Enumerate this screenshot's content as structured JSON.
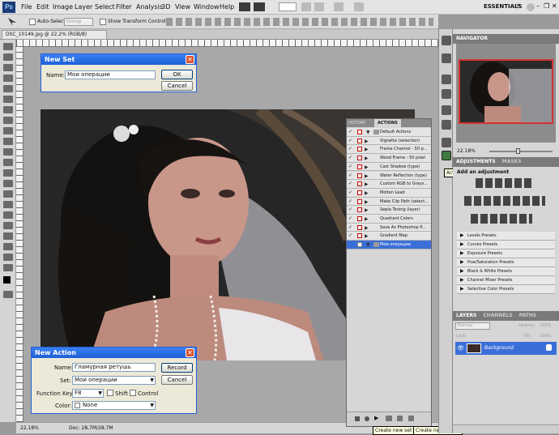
{
  "app": {
    "logo": "Ps",
    "workspace": "ESSENTIALS",
    "cs_live": "CS Live"
  },
  "menu": [
    "File",
    "Edit",
    "Image",
    "Layer",
    "Select",
    "Filter",
    "Analysis",
    "3D",
    "View",
    "Window",
    "Help"
  ],
  "options": {
    "auto_select_label": "Auto-Select:",
    "auto_select_value": "Group",
    "transform_label": "Show Transform Controls"
  },
  "document": {
    "tab_title": "DSC_10149.jpg @ 22,2% (RGB/8)"
  },
  "status": {
    "zoom": "22,18%",
    "doc": "Doc: 28,7M/28,7M"
  },
  "new_set_dialog": {
    "title": "New Set",
    "name_label": "Name:",
    "name_value": "Мои операции",
    "ok": "OK",
    "cancel": "Cancel"
  },
  "new_action_dialog": {
    "title": "New Action",
    "name_label": "Name:",
    "name_value": "Гламурная ретушь",
    "set_label": "Set:",
    "set_value": "Мои операции",
    "fkey_label": "Function Key:",
    "fkey_value": "F8",
    "shift": "Shift",
    "control": "Control",
    "color_label": "Color:",
    "color_value": "None",
    "record": "Record",
    "cancel": "Cancel"
  },
  "actions_panel": {
    "tabs": [
      "HISTORY",
      "ACTIONS"
    ],
    "items": [
      {
        "name": "Default Actions",
        "folder": true
      },
      {
        "name": "Vignette (selection)"
      },
      {
        "name": "Frame Channel - 50 p..."
      },
      {
        "name": "Wood Frame - 50 pixel"
      },
      {
        "name": "Cast Shadow (type)"
      },
      {
        "name": "Water Reflection (type)"
      },
      {
        "name": "Custom RGB to Grays..."
      },
      {
        "name": "Molten Lead"
      },
      {
        "name": "Make Clip Path (select..."
      },
      {
        "name": "Sepia Toning (layer)"
      },
      {
        "name": "Quadrant Colors"
      },
      {
        "name": "Save As Photoshop P..."
      },
      {
        "name": "Gradient Map"
      },
      {
        "name": "Мои операции",
        "selected": true
      }
    ],
    "tip_new_set": "Create new set",
    "tip_new_action": "Create new action"
  },
  "dock_tooltip": "Actions",
  "navigator": {
    "title": "NAVIGATOR",
    "zoom": "22.18%"
  },
  "adjustments": {
    "tabs": [
      "ADJUSTMENTS",
      "MASKS"
    ],
    "heading": "Add an adjustment",
    "presets": [
      "Levels Presets",
      "Curves Presets",
      "Exposure Presets",
      "Hue/Saturation Presets",
      "Black & White Presets",
      "Channel Mixer Presets",
      "Selective Color Presets"
    ]
  },
  "layers": {
    "tabs": [
      "LAYERS",
      "CHANNELS",
      "PATHS"
    ],
    "blend": "Normal",
    "opacity_label": "Opacity:",
    "opacity": "100%",
    "lock_label": "Lock:",
    "fill_label": "Fill:",
    "fill": "100%",
    "layer_name": "Background"
  }
}
